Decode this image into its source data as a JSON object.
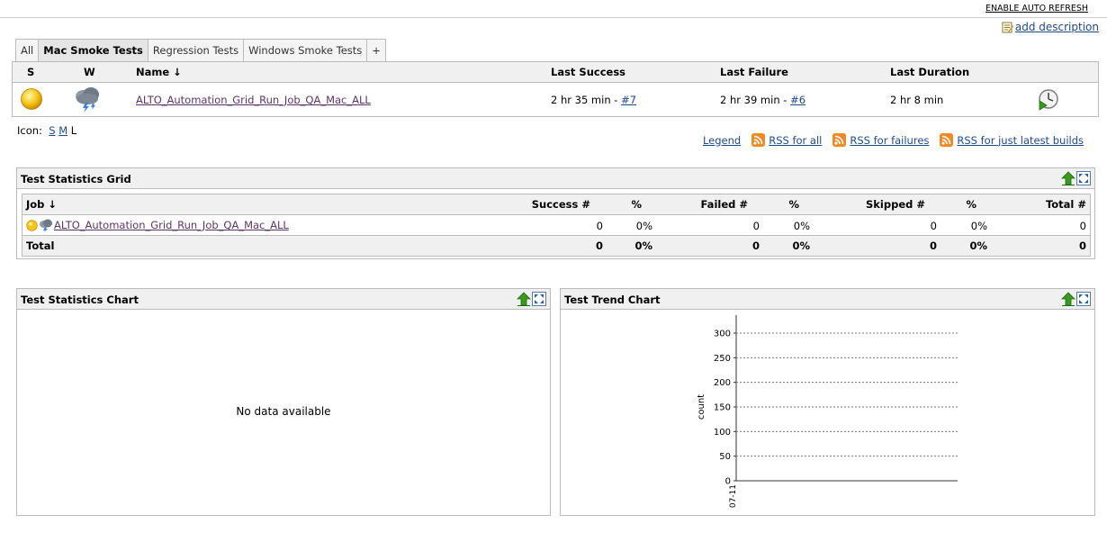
{
  "header": {
    "auto_refresh": "ENABLE AUTO REFRESH",
    "add_description": "add description"
  },
  "tabs": [
    {
      "label": "All",
      "active": false
    },
    {
      "label": "Mac Smoke Tests",
      "active": true
    },
    {
      "label": "Regression Tests",
      "active": false
    },
    {
      "label": "Windows Smoke Tests",
      "active": false
    },
    {
      "label": "+",
      "active": false
    }
  ],
  "projects": {
    "columns": [
      "S",
      "W",
      "Name ↓",
      "Last Success",
      "Last Failure",
      "Last Duration"
    ],
    "rows": [
      {
        "name": "ALTO_Automation_Grid_Run_Job_QA_Mac_ALL",
        "last_success": "2 hr 35 min - ",
        "last_success_build": "#7",
        "last_failure": "2 hr 39 min - ",
        "last_failure_build": "#6",
        "last_duration": "2 hr 8 min"
      }
    ]
  },
  "icon_size": {
    "label": "Icon:",
    "options": [
      "S",
      "M",
      "L"
    ]
  },
  "rss": {
    "legend": "Legend",
    "all": "RSS for all",
    "failures": "RSS for failures",
    "latest": "RSS for just latest builds"
  },
  "test_grid": {
    "title": "Test Statistics Grid",
    "columns": [
      "Job ↓",
      "Success #",
      "%",
      "Failed #",
      "%",
      "Skipped #",
      "%",
      "Total #"
    ],
    "row": {
      "job": "ALTO_Automation_Grid_Run_Job_QA_Mac_ALL",
      "success": "0",
      "success_pct": "0%",
      "failed": "0",
      "failed_pct": "0%",
      "skipped": "0",
      "skipped_pct": "0%",
      "total": "0"
    },
    "total": {
      "label": "Total",
      "success": "0",
      "success_pct": "0%",
      "failed": "0",
      "failed_pct": "0%",
      "skipped": "0",
      "skipped_pct": "0%",
      "total": "0"
    }
  },
  "stats_chart": {
    "title": "Test Statistics Chart",
    "empty_text": "No data available"
  },
  "trend_chart": {
    "title": "Test Trend Chart"
  },
  "chart_data": {
    "type": "line",
    "x": [
      "07-11"
    ],
    "series": [],
    "title": "",
    "xlabel": "",
    "ylabel": "count",
    "ylim": [
      0,
      300
    ],
    "yticks": [
      0,
      50,
      100,
      150,
      200,
      250,
      300
    ],
    "grid": true
  },
  "colors": {
    "link": "#204a87",
    "visited_link": "#5c3566",
    "header_bg": "#f0f0f0",
    "border": "#bbbbbb",
    "rss": "#f08a24",
    "status_sun": "#f5c518",
    "up_arrow": "#3a9a1f"
  },
  "icons": {
    "status": "yellow-ball-icon",
    "weather": "thunderstorm-icon",
    "build": "clock-play-icon",
    "edit": "notepad-icon",
    "rss": "rss-icon",
    "portlet_up": "green-up-arrow-icon",
    "portlet_max": "maximize-icon"
  }
}
